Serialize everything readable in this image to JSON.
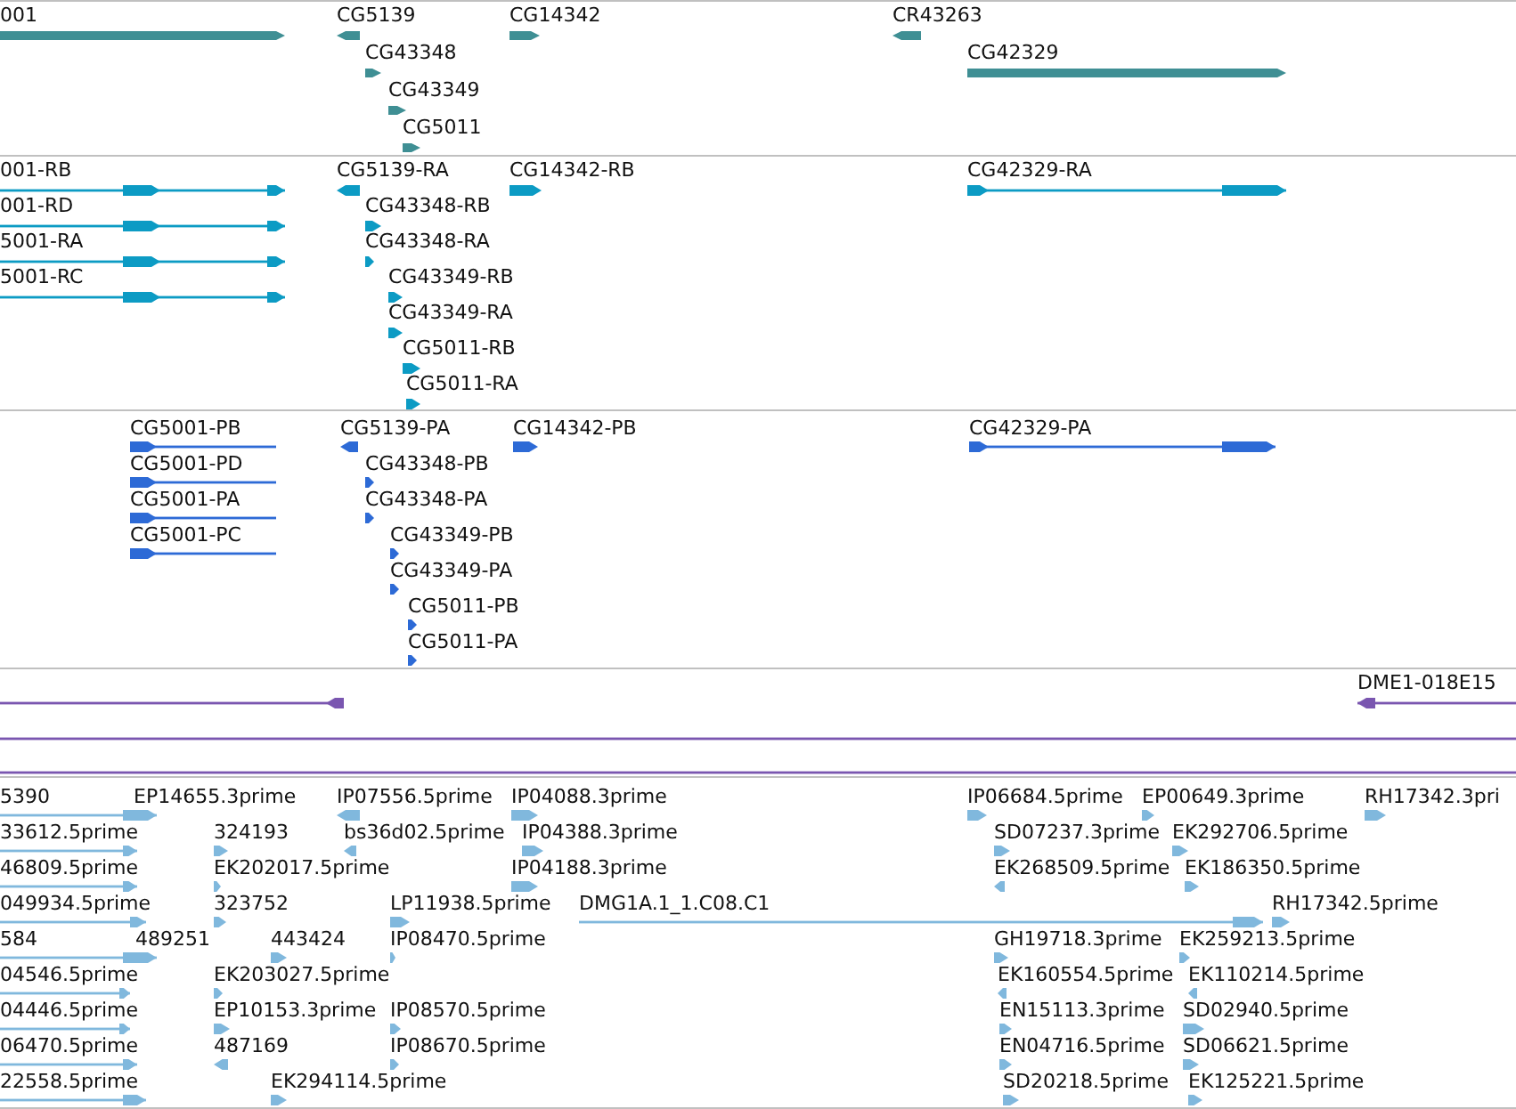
{
  "tracks": [
    {
      "kind": "genes",
      "features": [
        {
          "label": "001",
          "reverse": false
        },
        {
          "label": "CG5139",
          "reverse": true
        },
        {
          "label": "CG14342",
          "reverse": false
        },
        {
          "label": "CR43263",
          "reverse": true
        },
        {
          "label": "CG43348",
          "reverse": false
        },
        {
          "label": "CG42329",
          "reverse": false
        },
        {
          "label": "CG43349",
          "reverse": false
        },
        {
          "label": "CG5011",
          "reverse": false
        }
      ]
    },
    {
      "kind": "transcripts",
      "features": [
        {
          "label": "001-RB",
          "reverse": false
        },
        {
          "label": "CG5139-RA",
          "reverse": true
        },
        {
          "label": "CG14342-RB",
          "reverse": false
        },
        {
          "label": "CG42329-RA",
          "reverse": false
        },
        {
          "label": "001-RD",
          "reverse": false
        },
        {
          "label": "CG43348-RB",
          "reverse": false
        },
        {
          "label": "5001-RA",
          "reverse": false
        },
        {
          "label": "CG43348-RA",
          "reverse": false
        },
        {
          "label": "5001-RC",
          "reverse": false
        },
        {
          "label": "CG43349-RB",
          "reverse": false
        },
        {
          "label": "CG43349-RA",
          "reverse": false
        },
        {
          "label": "CG5011-RB",
          "reverse": false
        },
        {
          "label": "CG5011-RA",
          "reverse": false
        }
      ]
    },
    {
      "kind": "proteins",
      "features": [
        {
          "label": "CG5001-PB",
          "reverse": false
        },
        {
          "label": "CG5139-PA",
          "reverse": true
        },
        {
          "label": "CG14342-PB",
          "reverse": false
        },
        {
          "label": "CG42329-PA",
          "reverse": false
        },
        {
          "label": "CG5001-PD",
          "reverse": false
        },
        {
          "label": "CG43348-PB",
          "reverse": false
        },
        {
          "label": "CG5001-PA",
          "reverse": false
        },
        {
          "label": "CG43348-PA",
          "reverse": false
        },
        {
          "label": "CG5001-PC",
          "reverse": false
        },
        {
          "label": "CG43349-PB",
          "reverse": false
        },
        {
          "label": "CG43349-PA",
          "reverse": false
        },
        {
          "label": "CG5011-PB",
          "reverse": false
        },
        {
          "label": "CG5011-PA",
          "reverse": false
        }
      ]
    },
    {
      "kind": "clones",
      "features": [
        {
          "kind": "feature",
          "reverse": true
        },
        {
          "kind": "feature",
          "label": "DME1-018E15",
          "reverse": true
        },
        {
          "kind": "span"
        },
        {
          "kind": "span"
        }
      ]
    },
    {
      "kind": "ests",
      "features": [
        {
          "label": "5390",
          "reverse": false
        },
        {
          "label": "EP14655.3prime"
        },
        {
          "label": "IP07556.5prime",
          "reverse": true
        },
        {
          "label": "IP04088.3prime",
          "reverse": false
        },
        {
          "label": "IP06684.5prime",
          "reverse": false
        },
        {
          "label": "EP00649.3prime",
          "reverse": false
        },
        {
          "label": "RH17342.3pri",
          "reverse": false
        },
        {
          "label": "33612.5prime",
          "reverse": false
        },
        {
          "label": "324193",
          "reverse": false
        },
        {
          "label": "bs36d02.5prime",
          "reverse": true
        },
        {
          "label": "IP04388.3prime",
          "reverse": false
        },
        {
          "label": "SD07237.3prime",
          "reverse": false
        },
        {
          "label": "EK292706.5prime",
          "reverse": false
        },
        {
          "label": "46809.5prime",
          "reverse": false
        },
        {
          "label": "EK202017.5prime",
          "reverse": false
        },
        {
          "label": "IP04188.3prime",
          "reverse": false
        },
        {
          "label": "EK268509.5prime",
          "reverse": true
        },
        {
          "label": "EK186350.5prime",
          "reverse": false
        },
        {
          "label": "049934.5prime",
          "reverse": false
        },
        {
          "label": "323752",
          "reverse": false
        },
        {
          "label": "LP11938.5prime",
          "reverse": false
        },
        {
          "label": "DMG1A.1_1.C08.C1",
          "reverse": false
        },
        {
          "label": "RH17342.5prime",
          "reverse": false
        },
        {
          "label": "584",
          "reverse": false
        },
        {
          "label": "489251"
        },
        {
          "label": "443424",
          "reverse": false
        },
        {
          "label": "IP08470.5prime",
          "reverse": false
        },
        {
          "label": "GH19718.3prime",
          "reverse": false
        },
        {
          "label": "EK259213.5prime",
          "reverse": false
        },
        {
          "label": "04546.5prime",
          "reverse": false
        },
        {
          "label": "EK203027.5prime",
          "reverse": false
        },
        {
          "label": "EK160554.5prime",
          "reverse": true
        },
        {
          "label": "EK110214.5prime",
          "reverse": true
        },
        {
          "label": "04446.5prime",
          "reverse": false
        },
        {
          "label": "EP10153.3prime",
          "reverse": false
        },
        {
          "label": "IP08570.5prime",
          "reverse": false
        },
        {
          "label": "EN15113.3prime",
          "reverse": false
        },
        {
          "label": "SD02940.5prime",
          "reverse": false
        },
        {
          "label": "06470.5prime",
          "reverse": false
        },
        {
          "label": "487169",
          "reverse": true
        },
        {
          "label": "IP08670.5prime",
          "reverse": false
        },
        {
          "label": "EN04716.5prime",
          "reverse": false
        },
        {
          "label": "SD06621.5prime",
          "reverse": false
        },
        {
          "label": "22558.5prime",
          "reverse": false
        },
        {
          "label": "EK294114.5prime",
          "reverse": false
        },
        {
          "label": "SD20218.5prime",
          "reverse": false
        },
        {
          "label": "EK125221.5prime",
          "reverse": false
        }
      ]
    }
  ]
}
